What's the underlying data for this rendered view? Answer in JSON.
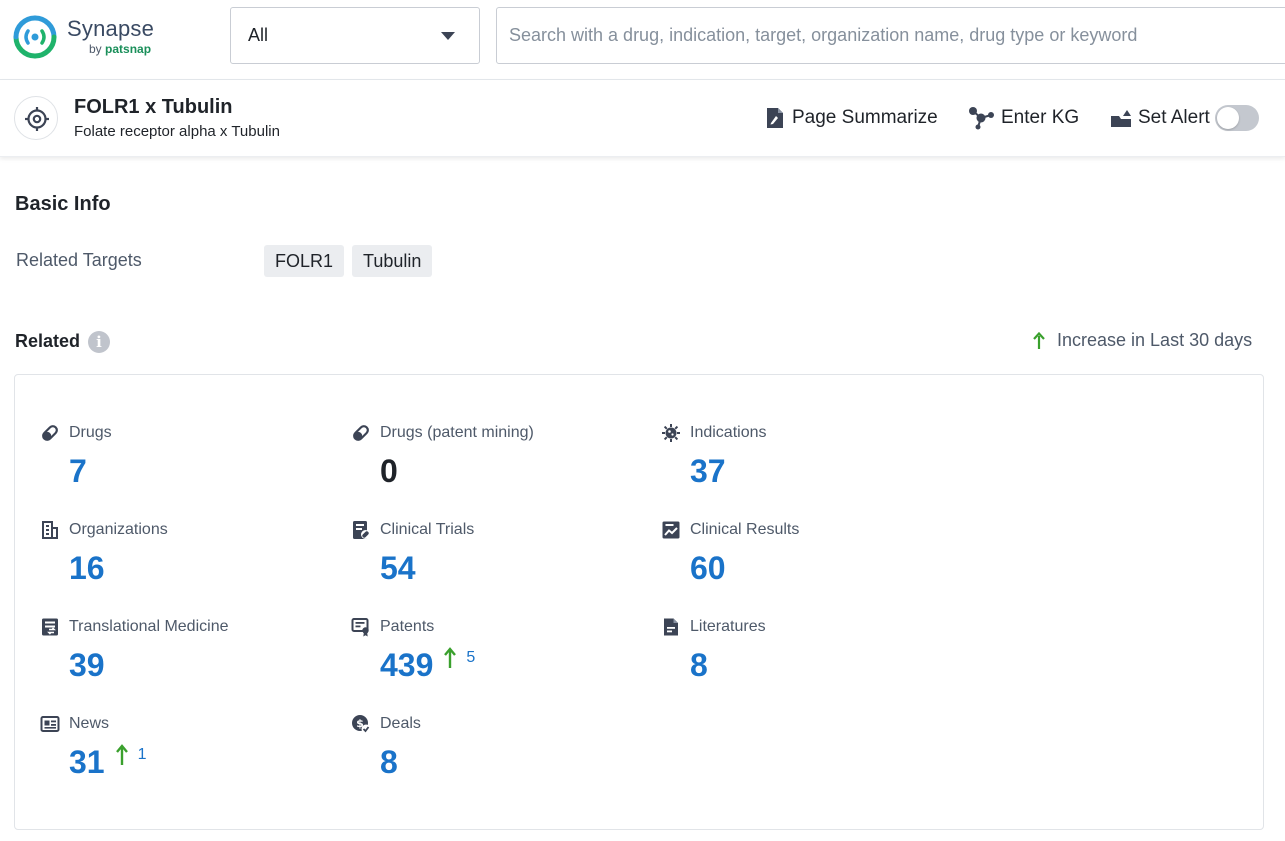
{
  "app": {
    "name": "Synapse",
    "by_prefix": "by",
    "by_brand": "patsnap"
  },
  "search": {
    "scope_value": "All",
    "placeholder": "Search with a drug, indication, target, organization name, drug type or keyword",
    "value": ""
  },
  "entity": {
    "title": "FOLR1 x Tubulin",
    "subtitle": "Folate receptor alpha x Tubulin",
    "icon": "target-icon"
  },
  "actions": {
    "page_summarize": "Page Summarize",
    "enter_kg": "Enter KG",
    "set_alert": "Set Alert",
    "alert_enabled": false
  },
  "basic_info": {
    "title": "Basic Info",
    "related_targets_label": "Related Targets",
    "related_targets": [
      "FOLR1",
      "Tubulin"
    ]
  },
  "related": {
    "title": "Related",
    "legend": "Increase in Last 30 days",
    "accent_color": "#1a73c9",
    "increase_color": "#3aa02d",
    "stats": [
      {
        "label": "Drugs",
        "value": "7",
        "delta": "",
        "icon": "pill-icon"
      },
      {
        "label": "Drugs (patent mining)",
        "value": "0",
        "delta": "",
        "icon": "pill-icon"
      },
      {
        "label": "Indications",
        "value": "37",
        "delta": "",
        "icon": "virus-icon"
      },
      {
        "label": "Organizations",
        "value": "16",
        "delta": "",
        "icon": "building-icon"
      },
      {
        "label": "Clinical Trials",
        "value": "54",
        "delta": "",
        "icon": "clinical-trial-icon"
      },
      {
        "label": "Clinical Results",
        "value": "60",
        "delta": "",
        "icon": "chart-report-icon"
      },
      {
        "label": "Translational Medicine",
        "value": "39",
        "delta": "",
        "icon": "translational-doc-icon"
      },
      {
        "label": "Patents",
        "value": "439",
        "delta": "5",
        "icon": "patent-certificate-icon"
      },
      {
        "label": "Literatures",
        "value": "8",
        "delta": "",
        "icon": "document-icon"
      },
      {
        "label": "News",
        "value": "31",
        "delta": "1",
        "icon": "newspaper-icon"
      },
      {
        "label": "Deals",
        "value": "8",
        "delta": "",
        "icon": "deal-coin-icon"
      }
    ]
  }
}
